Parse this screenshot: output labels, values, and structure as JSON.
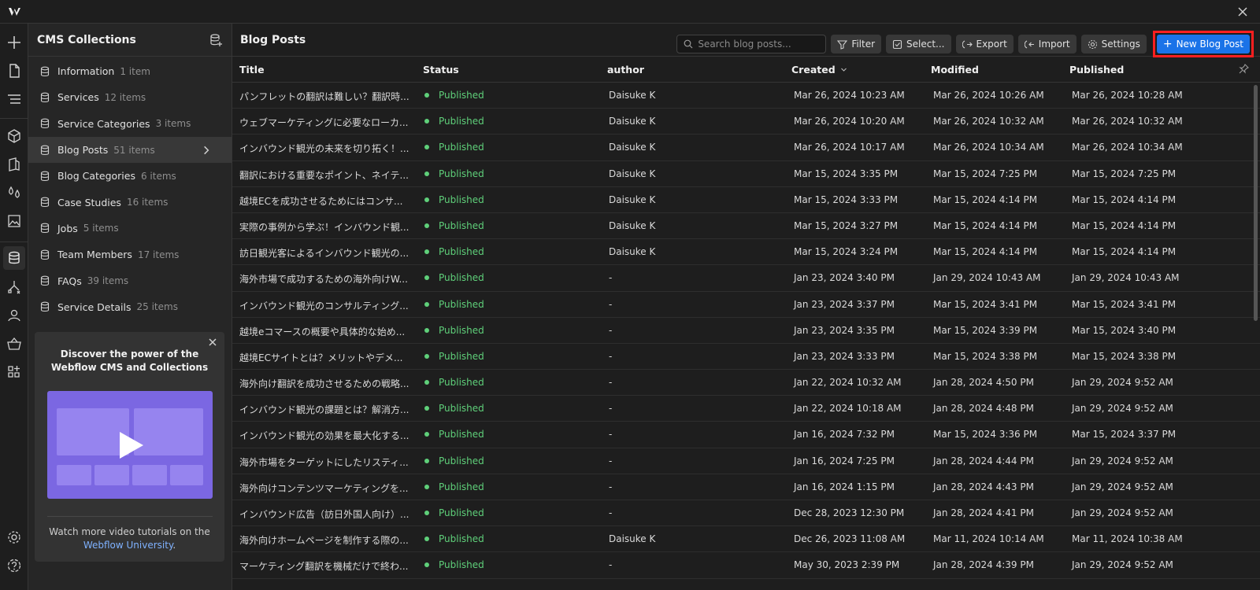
{
  "app": {
    "close_label": "×"
  },
  "panel": {
    "title": "CMS Collections",
    "collections": [
      {
        "name": "Information",
        "count": "1 item"
      },
      {
        "name": "Services",
        "count": "12 items"
      },
      {
        "name": "Service Categories",
        "count": "3 items"
      },
      {
        "name": "Blog Posts",
        "count": "51 items",
        "active": true
      },
      {
        "name": "Blog Categories",
        "count": "6 items"
      },
      {
        "name": "Case Studies",
        "count": "16 items"
      },
      {
        "name": "Jobs",
        "count": "5 items"
      },
      {
        "name": "Team Members",
        "count": "17 items"
      },
      {
        "name": "FAQs",
        "count": "39 items"
      },
      {
        "name": "Service Details",
        "count": "25 items"
      }
    ],
    "promo": {
      "title": "Discover the power of the Webflow CMS and Collections",
      "text": "Watch more video tutorials on the",
      "link": "Webflow University",
      "link_suffix": "."
    }
  },
  "main": {
    "title": "Blog Posts",
    "search_placeholder": "Search blog posts...",
    "buttons": {
      "filter": "Filter",
      "select": "Select...",
      "export": "Export",
      "import": "Import",
      "settings": "Settings",
      "new": "New Blog Post"
    },
    "columns": {
      "title": "Title",
      "status": "Status",
      "author": "author",
      "created": "Created",
      "modified": "Modified",
      "published": "Published"
    },
    "rows": [
      {
        "title": "パンフレットの翻訳は難しい？翻訳時...",
        "status": "Published",
        "author": "Daisuke K",
        "created": "Mar 26, 2024 10:23 AM",
        "modified": "Mar 26, 2024 10:26 AM",
        "published": "Mar 26, 2024 10:28 AM"
      },
      {
        "title": "ウェブマーケティングに必要なローカ...",
        "status": "Published",
        "author": "Daisuke K",
        "created": "Mar 26, 2024 10:20 AM",
        "modified": "Mar 26, 2024 10:32 AM",
        "published": "Mar 26, 2024 10:32 AM"
      },
      {
        "title": "インバウンド観光の未来を切り拓く！...",
        "status": "Published",
        "author": "Daisuke K",
        "created": "Mar 26, 2024 10:17 AM",
        "modified": "Mar 26, 2024 10:34 AM",
        "published": "Mar 26, 2024 10:34 AM"
      },
      {
        "title": "翻訳における重要なポイント、ネイテ...",
        "status": "Published",
        "author": "Daisuke K",
        "created": "Mar 15, 2024 3:35 PM",
        "modified": "Mar 15, 2024 7:25 PM",
        "published": "Mar 15, 2024 7:25 PM"
      },
      {
        "title": "越境ECを成功させるためにはコンサ...",
        "status": "Published",
        "author": "Daisuke K",
        "created": "Mar 15, 2024 3:33 PM",
        "modified": "Mar 15, 2024 4:14 PM",
        "published": "Mar 15, 2024 4:14 PM"
      },
      {
        "title": "実際の事例から学ぶ！インバウンド観...",
        "status": "Published",
        "author": "Daisuke K",
        "created": "Mar 15, 2024 3:27 PM",
        "modified": "Mar 15, 2024 4:14 PM",
        "published": "Mar 15, 2024 4:14 PM"
      },
      {
        "title": "訪日観光客によるインバウンド観光の...",
        "status": "Published",
        "author": "Daisuke K",
        "created": "Mar 15, 2024 3:24 PM",
        "modified": "Mar 15, 2024 4:14 PM",
        "published": "Mar 15, 2024 4:14 PM"
      },
      {
        "title": "海外市場で成功するための海外向けW...",
        "status": "Published",
        "author": "-",
        "created": "Jan 23, 2024 3:40 PM",
        "modified": "Jan 29, 2024 10:43 AM",
        "published": "Jan 29, 2024 10:43 AM"
      },
      {
        "title": "インバウンド観光のコンサルティング...",
        "status": "Published",
        "author": "-",
        "created": "Jan 23, 2024 3:37 PM",
        "modified": "Mar 15, 2024 3:41 PM",
        "published": "Mar 15, 2024 3:41 PM"
      },
      {
        "title": "越境eコマースの概要や具体的な始め...",
        "status": "Published",
        "author": "-",
        "created": "Jan 23, 2024 3:35 PM",
        "modified": "Mar 15, 2024 3:39 PM",
        "published": "Mar 15, 2024 3:40 PM"
      },
      {
        "title": "越境ECサイトとは？メリットやデメ...",
        "status": "Published",
        "author": "-",
        "created": "Jan 23, 2024 3:33 PM",
        "modified": "Mar 15, 2024 3:38 PM",
        "published": "Mar 15, 2024 3:38 PM"
      },
      {
        "title": "海外向け翻訳を成功させるための戦略...",
        "status": "Published",
        "author": "-",
        "created": "Jan 22, 2024 10:32 AM",
        "modified": "Jan 28, 2024 4:50 PM",
        "published": "Jan 29, 2024 9:52 AM"
      },
      {
        "title": "インバウンド観光の課題とは？解消方...",
        "status": "Published",
        "author": "-",
        "created": "Jan 22, 2024 10:18 AM",
        "modified": "Jan 28, 2024 4:48 PM",
        "published": "Jan 29, 2024 9:52 AM"
      },
      {
        "title": "インバウンド観光の効果を最大化する...",
        "status": "Published",
        "author": "-",
        "created": "Jan 16, 2024 7:32 PM",
        "modified": "Mar 15, 2024 3:36 PM",
        "published": "Mar 15, 2024 3:37 PM"
      },
      {
        "title": "海外市場をターゲットにしたリスティ...",
        "status": "Published",
        "author": "-",
        "created": "Jan 16, 2024 7:25 PM",
        "modified": "Jan 28, 2024 4:44 PM",
        "published": "Jan 29, 2024 9:52 AM"
      },
      {
        "title": "海外向けコンテンツマーケティングを...",
        "status": "Published",
        "author": "-",
        "created": "Jan 16, 2024 1:15 PM",
        "modified": "Jan 28, 2024 4:43 PM",
        "published": "Jan 29, 2024 9:52 AM"
      },
      {
        "title": "インバウンド広告（訪日外国人向け）...",
        "status": "Published",
        "author": "-",
        "created": "Dec 28, 2023 12:30 PM",
        "modified": "Jan 28, 2024 4:41 PM",
        "published": "Jan 29, 2024 9:52 AM"
      },
      {
        "title": "海外向けホームページを制作する際の...",
        "status": "Published",
        "author": "Daisuke K",
        "created": "Dec 26, 2023 11:08 AM",
        "modified": "Mar 11, 2024 10:14 AM",
        "published": "Mar 11, 2024 10:38 AM"
      },
      {
        "title": "マーケティング翻訳を機械だけで終わ...",
        "status": "Published",
        "author": "-",
        "created": "May 30, 2023 2:39 PM",
        "modified": "Jan 28, 2024 4:39 PM",
        "published": "Jan 29, 2024 9:52 AM"
      }
    ]
  },
  "icons": {
    "logo": "webflow-logo-icon",
    "status_color": "#5fd07a",
    "accent": "#1a73e8",
    "highlight": "#ff1f1f"
  }
}
